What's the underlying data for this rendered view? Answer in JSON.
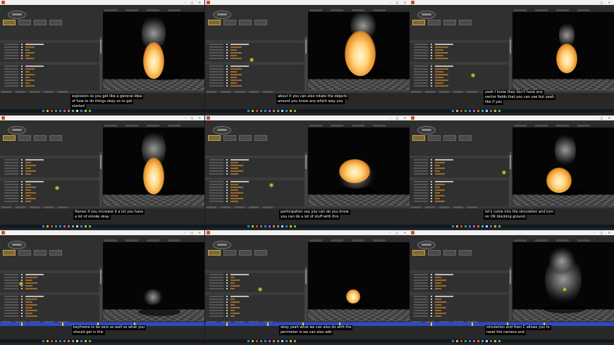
{
  "colors": {
    "accent": "#d4a640",
    "timeline_blue": "#2a4ad0",
    "fire": "#ffd47a",
    "background": "#262626"
  },
  "panels": [
    {
      "id": "p1",
      "subtitle_lines": [
        "explosion so you get like a general idea",
        "of how to do things okay so to get",
        "started"
      ],
      "timeline": false
    },
    {
      "id": "p2",
      "subtitle_lines": [
        "about it you can also rotate the objects",
        "around you know any which way you"
      ],
      "timeline": false
    },
    {
      "id": "p3",
      "subtitle_lines": [
        "yeah I know they don't have any",
        "vector fields that you can use but yeah",
        "like if you"
      ],
      "timeline": false
    },
    {
      "id": "p4",
      "subtitle_lines": [
        "flames if you increase it a lot you have",
        "a lot of smoke okay"
      ],
      "timeline": false
    },
    {
      "id": "p5",
      "subtitle_lines": [
        "participation say you can do you know",
        "you can do a lot of stuff with this"
      ],
      "timeline": false
    },
    {
      "id": "p6",
      "subtitle_lines": [
        "let's come into the simulation and turn",
        "on OK blocking ground"
      ],
      "timeline": false
    },
    {
      "id": "p7",
      "subtitle_lines": [
        "keyframe to be zero as well so what you",
        "should get is this"
      ],
      "timeline": true
    },
    {
      "id": "p8",
      "subtitle_lines": [
        "okay yeah what we can also do with the",
        "perimeter is we can also add"
      ],
      "timeline": true
    },
    {
      "id": "p9",
      "subtitle_lines": [
        "simulation and then C allows you to",
        "reset the camera and"
      ],
      "timeline": true
    }
  ]
}
